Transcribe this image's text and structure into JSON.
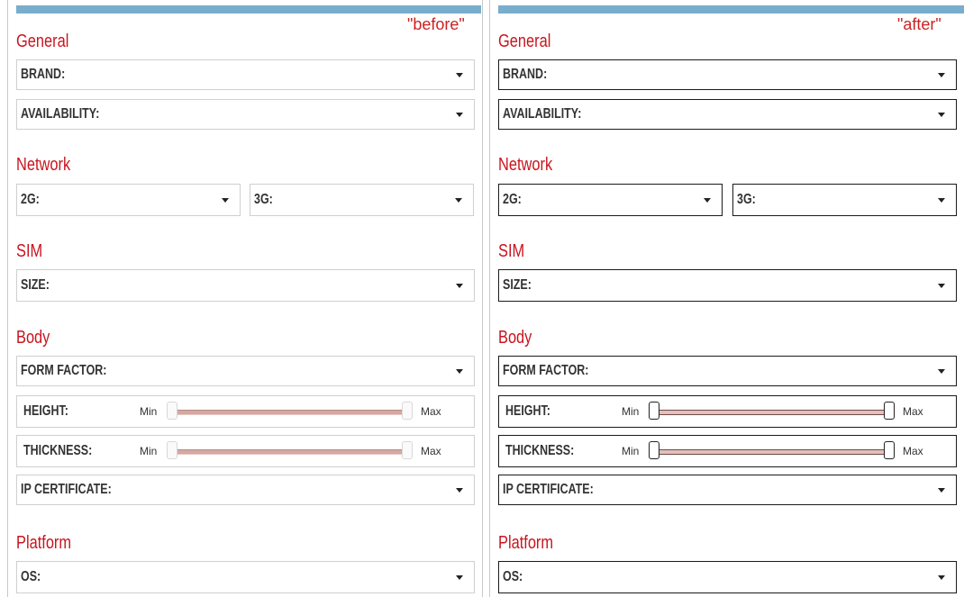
{
  "panels": {
    "before": {
      "caption": "\"before\"",
      "sections": {
        "general": "General",
        "network": "Network",
        "sim": "SIM",
        "body": "Body",
        "platform": "Platform"
      },
      "fields": {
        "brand": "BRAND:",
        "availability": "AVAILABILITY:",
        "g2": "2G:",
        "g3": "3G:",
        "size": "SIZE:",
        "form_factor": "FORM FACTOR:",
        "height": "HEIGHT:",
        "thickness": "THICKNESS:",
        "ip_certificate": "IP CERTIFICATE:",
        "os": "OS:"
      },
      "slider_min": "Min",
      "slider_max": "Max"
    },
    "after": {
      "caption": "\"after\"",
      "sections": {
        "general": "General",
        "network": "Network",
        "sim": "SIM",
        "body": "Body",
        "platform": "Platform"
      },
      "fields": {
        "brand": "BRAND:",
        "availability": "AVAILABILITY:",
        "g2": "2G:",
        "g3": "3G:",
        "size": "SIZE:",
        "form_factor": "FORM FACTOR:",
        "height": "HEIGHT:",
        "thickness": "THICKNESS:",
        "ip_certificate": "IP CERTIFICATE:",
        "os": "OS:"
      },
      "slider_min": "Min",
      "slider_max": "Max"
    }
  },
  "icons": {
    "dropdown": "chevron-down-icon",
    "slider_handle": "slider-handle"
  },
  "colors": {
    "header_bar": "#78aecb",
    "section_title": "#c8141e",
    "caption": "#cc2222",
    "slider_track": "#d7a7a2"
  }
}
